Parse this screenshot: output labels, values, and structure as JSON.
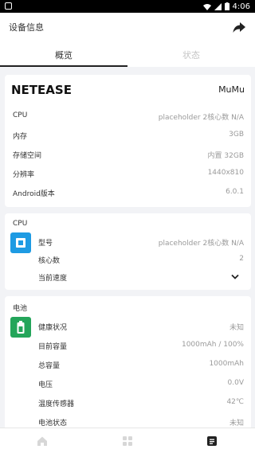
{
  "status_bar": {
    "time": "4:06"
  },
  "header": {
    "title": "设备信息"
  },
  "tabs": [
    {
      "label": "概览"
    },
    {
      "label": "状态"
    }
  ],
  "device": {
    "brand": "NETEASE",
    "model": "MuMu",
    "rows": [
      {
        "label": "CPU",
        "value": "placeholder 2核心数 N/A"
      },
      {
        "label": "内存",
        "value": "3GB"
      },
      {
        "label": "存储空间",
        "value": "内置 32GB"
      },
      {
        "label": "分辨率",
        "value": "1440x810"
      },
      {
        "label": "Android版本",
        "value": "6.0.1"
      }
    ]
  },
  "cpu": {
    "title": "CPU",
    "rows": [
      {
        "label": "型号",
        "value": "placeholder 2核心数 N/A"
      },
      {
        "label": "核心数",
        "value": "2"
      },
      {
        "label": "当前速度",
        "value": ""
      }
    ]
  },
  "battery": {
    "title": "电池",
    "rows": [
      {
        "label": "健康状况",
        "value": "未知"
      },
      {
        "label": "目前容量",
        "value": "1000mAh / 100%"
      },
      {
        "label": "总容量",
        "value": "1000mAh"
      },
      {
        "label": "电压",
        "value": "0.0V"
      },
      {
        "label": "温度传感器",
        "value": "42℃"
      },
      {
        "label": "电池状态",
        "value": "未知"
      }
    ]
  },
  "colors": {
    "cpu_icon": "#1e9be3",
    "battery_icon": "#24a55a",
    "background": "#f2f3f6"
  },
  "icons": {
    "status_right": [
      "wifi-icon",
      "cell-signal-icon",
      "battery-icon"
    ],
    "share": "share-icon",
    "nav": [
      "home-icon",
      "apps-grid-icon",
      "info-doc-icon"
    ]
  }
}
